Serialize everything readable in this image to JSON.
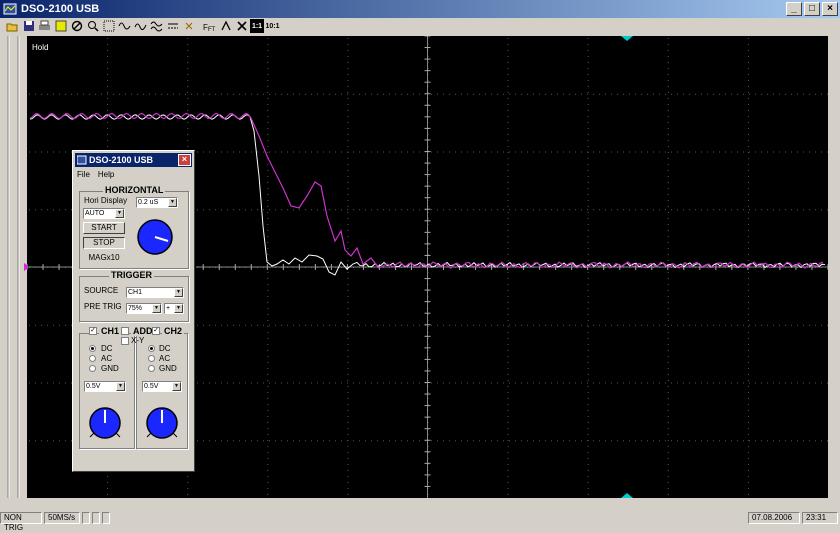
{
  "window": {
    "title": "DSO-2100 USB",
    "minimize": "_",
    "maximize": "□",
    "close": "×"
  },
  "screen": {
    "hold_label": "Hold",
    "trace1_color": "#ffffff",
    "trace2_color": "#cc33cc",
    "grid_color": "#555555",
    "marker_color": "#00cccc"
  },
  "toolbar": [
    "open-icon",
    "save-icon",
    "print-icon",
    "export-icon",
    "stop-icon",
    "zoom-icon",
    "grid-icon",
    "sine-icon",
    "sine2-icon",
    "math-icon",
    "cursor-icon",
    "marker-icon",
    "fft-icon",
    "probe-icon",
    "x-icon",
    "ratio1-icon",
    "ratio10-icon"
  ],
  "status": {
    "trig": "NON TRIG",
    "rate": "50MS/s",
    "date": "07.08.2006",
    "time": "23:31"
  },
  "panel": {
    "title": "DSO-2100 USB",
    "menu_file": "File",
    "menu_help": "Help",
    "horizontal": {
      "title": "HORIZONTAL",
      "hori_display_label": "Hori Display",
      "hori_display_value": "AUTO",
      "timebase_value": "0.2 uS",
      "start_label": "START",
      "stop_label": "STOP",
      "mag_label": "MAGx10"
    },
    "trigger": {
      "title": "TRIGGER",
      "source_label": "SOURCE",
      "source_value": "CH1",
      "pretrig_label": "PRE TRIG",
      "pretrig_value": "75%",
      "slope_value": "+"
    },
    "channels": {
      "ch1_label": "CH1",
      "add_label": "ADD",
      "xy_label": "X-Y",
      "ch2_label": "CH2",
      "dc": "DC",
      "ac": "AC",
      "gnd": "GND",
      "ch1_volts": "0.5V",
      "ch2_volts": "0.5V"
    }
  }
}
